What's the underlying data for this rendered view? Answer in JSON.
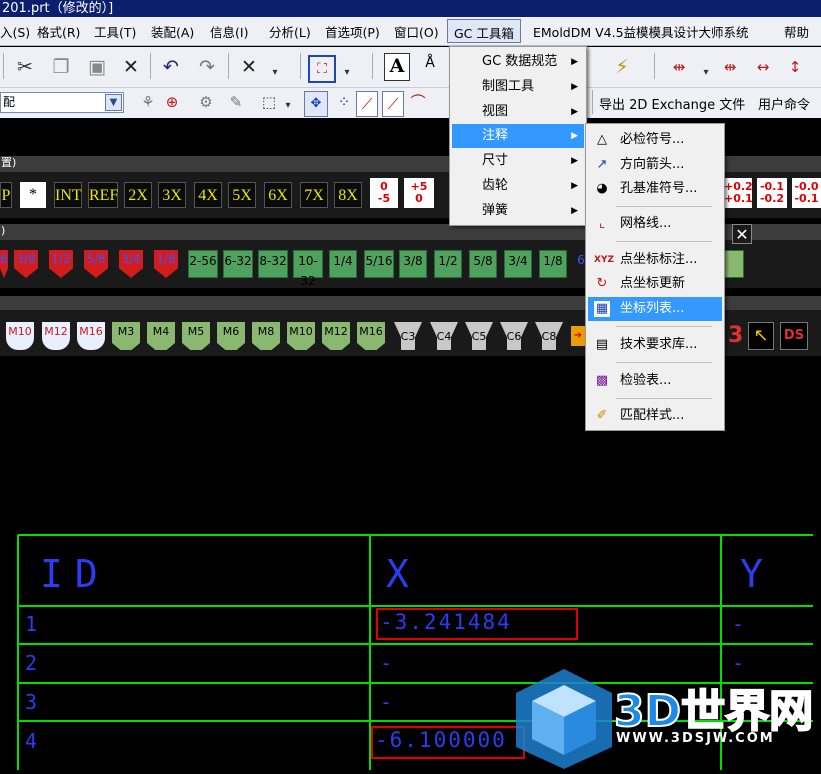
{
  "window": {
    "title": "201.prt（修改的）]"
  },
  "menubar": {
    "items": [
      "入(S)",
      "格式(R)",
      "工具(T)",
      "装配(A)",
      "信息(I)",
      "分析(L)",
      "首选项(P)",
      "窗口(O)",
      "GC 工具箱",
      "EMoldDM V4.5益模模具设计大师系统",
      "帮助"
    ]
  },
  "toolbar": {
    "filter_value": "配",
    "export_label": "导出 2D Exchange 文件",
    "user_command_label": "用户命令"
  },
  "bands": {
    "band1_label": "置)",
    "band2_label": ")",
    "scale_buttons": [
      "P",
      "*",
      "INT",
      "REF",
      "2X",
      "3X",
      "4X",
      "5X",
      "6X",
      "7X",
      "8X"
    ],
    "tol_left": [
      [
        "0",
        "-5"
      ],
      [
        "+5",
        "0"
      ]
    ],
    "tol_right": [
      [
        "+0.2",
        "+0.1"
      ],
      [
        "-0.1",
        "-0.2"
      ],
      [
        "-0.0",
        "-0.1"
      ]
    ],
    "pipe_red": [
      "6",
      "3/8",
      "1/2",
      "5/8",
      "3/4",
      "1/8"
    ],
    "pipe_green": [
      "2-56",
      "6-32",
      "8-32",
      "10-32",
      "1/4",
      "5/16",
      "3/8",
      "1/2",
      "5/8",
      "3/4",
      "1/8"
    ],
    "pipe_tail": "6",
    "screws_m": [
      "M10",
      "M12",
      "M16"
    ],
    "screws_g": [
      "M3",
      "M4",
      "M5",
      "M6",
      "M8",
      "M10",
      "M12",
      "M16"
    ],
    "screws_c": [
      "C3",
      "C4",
      "C5",
      "C6",
      "C8"
    ],
    "tail_labels": [
      "3",
      "DS"
    ]
  },
  "gc_menu": {
    "items": [
      {
        "label": "GC 数据规范",
        "submenu": true
      },
      {
        "label": "制图工具",
        "submenu": true
      },
      {
        "label": "视图",
        "submenu": true
      },
      {
        "label": "注释",
        "submenu": true
      },
      {
        "label": "尺寸",
        "submenu": true
      },
      {
        "label": "齿轮",
        "submenu": true
      },
      {
        "label": "弹簧",
        "submenu": true
      }
    ],
    "selected_index": 3
  },
  "annotation_submenu": {
    "items": [
      {
        "label": "必检符号...",
        "icon": "triangle-icon"
      },
      {
        "label": "方向箭头...",
        "icon": "direction-arrow-icon"
      },
      {
        "label": "孔基准符号...",
        "icon": "hole-datum-icon"
      },
      {
        "label": "网格线...",
        "icon": "grid-line-icon"
      },
      {
        "label": "点坐标标注...",
        "icon": "xyz-point-icon"
      },
      {
        "label": "点坐标更新",
        "icon": "refresh-icon"
      },
      {
        "label": "坐标列表...",
        "icon": "coordinate-list-icon"
      },
      {
        "label": "技术要求库...",
        "icon": "tech-requirements-icon"
      },
      {
        "label": "检验表...",
        "icon": "inspection-table-icon"
      },
      {
        "label": "匹配样式...",
        "icon": "match-style-icon"
      }
    ],
    "highlighted_index": 6
  },
  "coord_table": {
    "headers": [
      "ID",
      "X",
      "Y"
    ],
    "rows": [
      {
        "id": "1",
        "x": "-3.241484",
        "y": "-"
      },
      {
        "id": "2",
        "x": "-",
        "y": "-"
      },
      {
        "id": "3",
        "x": "-",
        "y": ""
      },
      {
        "id": "4",
        "x": "-6.100000",
        "y": ""
      }
    ],
    "line_color": "#00e000",
    "text_color": "#2b3df0",
    "highlight_color": "#e00000"
  },
  "watermark": {
    "brand": "3D世界网",
    "url": "WWW.3DSJW.COM"
  }
}
